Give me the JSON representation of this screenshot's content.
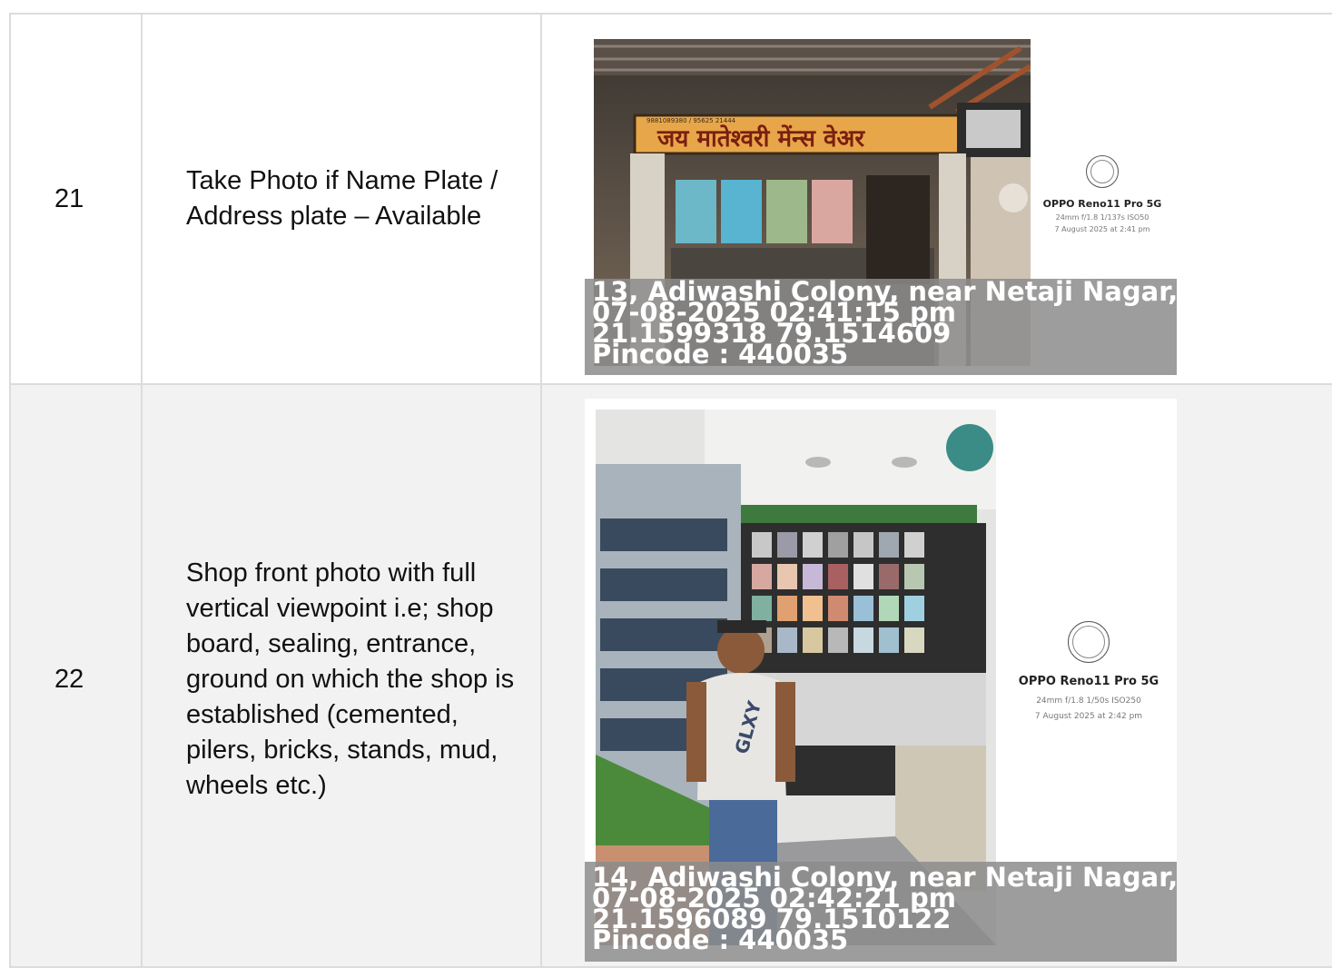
{
  "rows": [
    {
      "number": "21",
      "description": "Take Photo if Name Plate / Address plate – Available",
      "photo": {
        "camera": {
          "logo": "aperture-seal-icon",
          "model": "OPPO Reno11 Pro 5G",
          "settings": "24mm  f/1.8  1/137s  ISO50",
          "date": "7 August 2025 at 2:41 pm"
        },
        "sign_text": "जय मातेश्वरी मेंन्स वेअर",
        "sign_small": "9881089380 / 95625 21444",
        "stamp": {
          "address": "13, Adiwashi Colony, near Netaji Nagar, ...",
          "datetime": "07-08-2025 02:41:15 pm",
          "coords": "21.1599318 79.1514609",
          "pincode": "Pincode : 440035"
        }
      }
    },
    {
      "number": "22",
      "description": "Shop front photo with full vertical viewpoint i.e; shop board, sealing, entrance, ground on which the shop is established (cemented, pilers, bricks, stands, mud, wheels etc.)",
      "photo": {
        "camera": {
          "logo": "aperture-seal-icon",
          "model": "OPPO Reno11 Pro 5G",
          "settings": "24mm  f/1.8  1/50s  ISO250",
          "date": "7 August 2025 at 2:42 pm"
        },
        "shirt_print": "GLXY",
        "stamp": {
          "address": "14, Adiwashi Colony, near Netaji Nagar, ...",
          "datetime": "07-08-2025 02:42:21 pm",
          "coords": "21.1596089 79.1510122",
          "pincode": "Pincode : 440035"
        }
      }
    }
  ]
}
